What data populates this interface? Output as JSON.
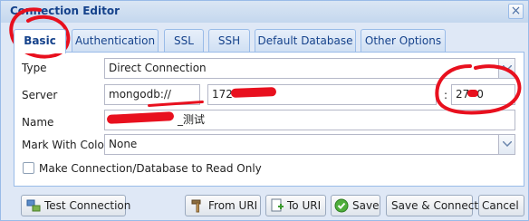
{
  "window": {
    "title": "Connection Editor",
    "close_glyph": "×"
  },
  "tabs": [
    {
      "label": "Basic",
      "active": true
    },
    {
      "label": "Authentication"
    },
    {
      "label": "SSL"
    },
    {
      "label": "SSH"
    },
    {
      "label": "Default Database"
    },
    {
      "label": "Other Options"
    }
  ],
  "form": {
    "type": {
      "label": "Type",
      "value": "Direct Connection"
    },
    "server": {
      "label": "Server",
      "scheme": "mongodb://",
      "host": "172",
      "separator": ":",
      "port": "27",
      "port_tail": "0"
    },
    "name": {
      "label": "Name",
      "value": "_测试"
    },
    "mark_color": {
      "label": "Mark With Color",
      "value": "None"
    },
    "read_only": {
      "label": "Make Connection/Database to Read Only",
      "checked": false
    }
  },
  "buttons": {
    "test": "Test Connection",
    "from_uri": "From URI",
    "to_uri": "To URI",
    "save": "Save",
    "save_connect": "Save & Connect",
    "cancel": "Cancel"
  },
  "colors": {
    "annotation": "#e8101e",
    "accent": "#15428b",
    "border": "#99bbe8"
  }
}
